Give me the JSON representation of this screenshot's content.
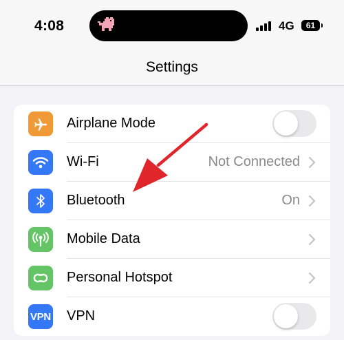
{
  "status_bar": {
    "time": "4:08",
    "network": "4G",
    "battery": "61"
  },
  "nav": {
    "title": "Settings"
  },
  "rows": [
    {
      "label": "Airplane Mode",
      "control": "toggle",
      "toggle_on": false,
      "icon": "airplane-icon",
      "icon_color": "#f09a37"
    },
    {
      "label": "Wi-Fi",
      "value": "Not Connected",
      "control": "chevron",
      "icon": "wifi-icon",
      "icon_color": "#3478f6"
    },
    {
      "label": "Bluetooth",
      "value": "On",
      "control": "chevron",
      "icon": "bluetooth-icon",
      "icon_color": "#3478f6"
    },
    {
      "label": "Mobile Data",
      "control": "chevron",
      "icon": "antenna-icon",
      "icon_color": "#65c466"
    },
    {
      "label": "Personal Hotspot",
      "control": "chevron",
      "icon": "hotspot-icon",
      "icon_color": "#65c466"
    },
    {
      "label": "VPN",
      "icon_text": "VPN",
      "control": "toggle",
      "toggle_on": false,
      "icon": "vpn-icon",
      "icon_color": "#3478f6"
    }
  ],
  "annotation": {
    "arrow_color": "#e0262b",
    "target": "Bluetooth"
  }
}
